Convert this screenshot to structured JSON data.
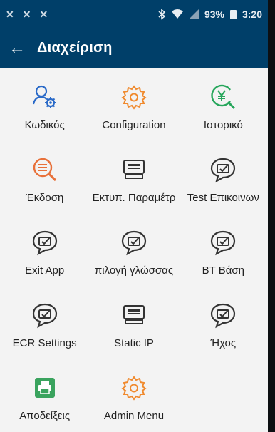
{
  "status_bar": {
    "left_icons": [
      "notification-x-icon",
      "notification-x-icon",
      "notification-x-icon"
    ],
    "left_symbols": [
      "✕",
      "✕",
      "✕"
    ],
    "battery": "93%",
    "time": "3:20"
  },
  "app_bar": {
    "title": "Διαχείριση"
  },
  "colors": {
    "primary": "#003f69",
    "accent_orange": "#f08a2e",
    "accent_green": "#26a65b",
    "accent_blue": "#2a6ac8",
    "icon_dark": "#333333"
  },
  "menu": {
    "items": [
      {
        "label": "Κωδικός",
        "icon": "user-gear-icon"
      },
      {
        "label": "Configuration",
        "icon": "gear-icon"
      },
      {
        "label": "Ιστορικό",
        "icon": "yen-search-icon"
      },
      {
        "label": "Έκδοση",
        "icon": "list-search-icon"
      },
      {
        "label": "Εκτυπ. Παραμέτρ",
        "icon": "terminal-icon"
      },
      {
        "label": "Test Επικοινων",
        "icon": "chat-bubble-icon"
      },
      {
        "label": "Exit App",
        "icon": "chat-bubble-icon"
      },
      {
        "label": "πιλογή γλώσσας",
        "icon": "chat-bubble-icon"
      },
      {
        "label": "BT Βάση",
        "icon": "chat-bubble-icon"
      },
      {
        "label": "ECR Settings",
        "icon": "chat-bubble-icon"
      },
      {
        "label": "Static IP",
        "icon": "terminal-icon"
      },
      {
        "label": "Ήχος",
        "icon": "chat-bubble-icon"
      },
      {
        "label": "Αποδείξεις",
        "icon": "printer-icon"
      },
      {
        "label": "Admin Menu",
        "icon": "gear-icon"
      }
    ]
  }
}
